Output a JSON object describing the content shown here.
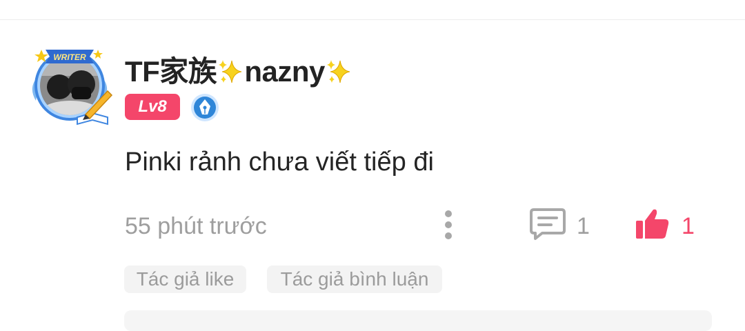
{
  "comment": {
    "author": {
      "name_prefix": "TF家族",
      "name_main": "nazny",
      "level": "Lv8",
      "avatar_frame_label": "WRITER",
      "name_emoji_icon": "sparkles-icon",
      "writer_badge_icon": "fountain-pen-badge-icon"
    },
    "text": "Pinki rảnh chưa viết tiếp đi",
    "time": "55 phút trước",
    "reply_count": "1",
    "like_count": "1",
    "tags": {
      "author_like": "Tác giả like",
      "author_comment": "Tác giả bình luận"
    }
  },
  "colors": {
    "accent": "#f4466a",
    "muted_text": "#9e9e9e",
    "tag_bg": "#f3f3f3",
    "badge_blue": "#2f86d8",
    "sparkle_yellow": "#f7d21e"
  },
  "icons": {
    "more": "vertical-dots-icon",
    "reply": "chat-bubble-icon",
    "like": "thumbs-up-icon"
  }
}
